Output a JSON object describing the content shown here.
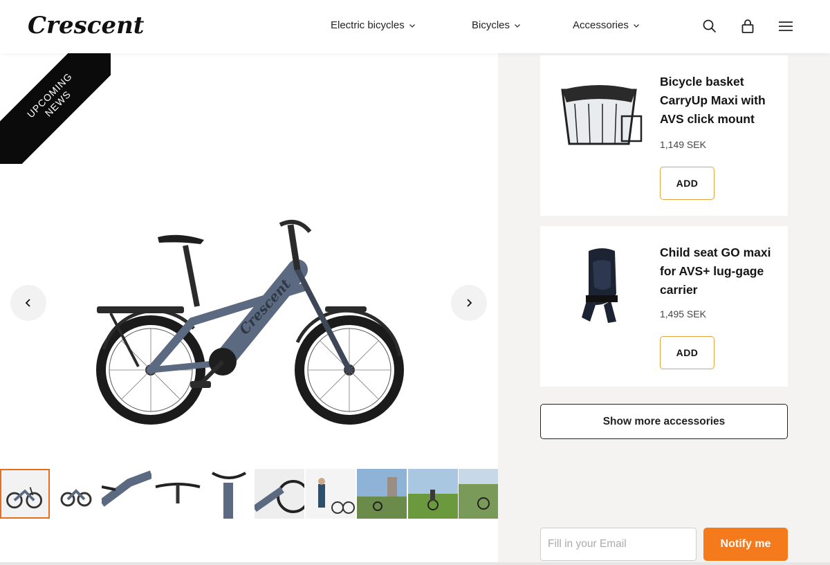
{
  "brand": {
    "logo_text": "Crescent"
  },
  "nav": {
    "items": [
      {
        "label": "Electric bicycles",
        "icon": "chevron-down-icon"
      },
      {
        "label": "Bicycles",
        "icon": "chevron-down-icon"
      },
      {
        "label": "Accessories",
        "icon": "chevron-down-icon"
      }
    ],
    "icons": [
      "search-icon",
      "bag-icon",
      "menu-icon"
    ]
  },
  "gallery": {
    "ribbon": {
      "line1": "UPCOMING",
      "line2": "NEWS"
    },
    "prev_icon": "chevron-left-icon",
    "next_icon": "chevron-right-icon",
    "thumbnail_count": 10,
    "active_thumbnail": 1
  },
  "accessories": {
    "items": [
      {
        "title": "Bicycle basket CarryUp Maxi with AVS click mount",
        "price": "1,149 SEK",
        "button": "ADD"
      },
      {
        "title": "Child seat GO maxi for AVS+ lug-gage carrier",
        "price": "1,495 SEK",
        "button": "ADD"
      }
    ],
    "show_more": "Show more accessories"
  },
  "notify": {
    "email_placeholder": "Fill in your Email",
    "email_value": "",
    "button": "Notify me"
  },
  "colors": {
    "accent": "#f47a1c",
    "add_border": "#e8a33a",
    "bike": "#5b6a80",
    "panel_bg": "#f5f3f1"
  }
}
